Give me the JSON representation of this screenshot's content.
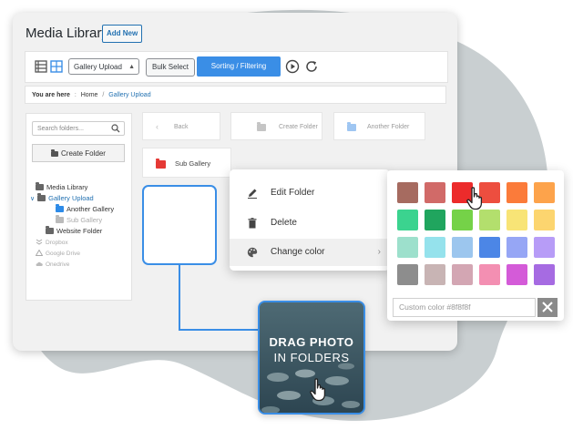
{
  "header": {
    "title": "Media Library",
    "add_new": "Add New"
  },
  "toolbar": {
    "view_list_icon": "list-view-icon",
    "view_grid_icon": "grid-view-icon",
    "folder_select": "Gallery Upload",
    "bulk_select": "Bulk Select",
    "sorting": "Sorting / Filtering",
    "play_icon": "play-circle-icon",
    "refresh_icon": "refresh-icon"
  },
  "breadcrumb": {
    "label": "You are here",
    "home": "Home",
    "current": "Gallery Upload"
  },
  "sidebar": {
    "search_placeholder": "Search folders...",
    "create_folder": "Create Folder",
    "tree": [
      {
        "label": "Media Library"
      },
      {
        "label": "Gallery Upload"
      },
      {
        "label": "Another Gallery"
      },
      {
        "label": "Sub Gallery"
      },
      {
        "label": "Website Folder"
      },
      {
        "label": "Dropbox"
      },
      {
        "label": "Google Drive"
      },
      {
        "label": "Onedrive"
      }
    ]
  },
  "folder_bar": {
    "back": "Back",
    "create_folder": "Create Folder",
    "another_folder": "Another Folder"
  },
  "sub_gallery": {
    "label": "Sub Gallery",
    "color": "#e53935"
  },
  "context_menu": {
    "edit": "Edit Folder",
    "delete": "Delete",
    "change_color": "Change color"
  },
  "palette": {
    "colors": [
      "#a66b60",
      "#d16a68",
      "#ec2b2b",
      "#ed4e3f",
      "#fb7b3a",
      "#fda34b",
      "#3bd38f",
      "#20a55e",
      "#75d248",
      "#b3df6d",
      "#f8e476",
      "#fcd56f",
      "#9de0cc",
      "#95e2ec",
      "#9cc6ee",
      "#4c86e6",
      "#96a6f5",
      "#b79cf7",
      "#8d8d8d",
      "#c8b4b4",
      "#d3a6b3",
      "#f38fb2",
      "#d45bd8",
      "#a66be2"
    ],
    "custom_placeholder": "Custom color #8f8f8f"
  },
  "drag_card": {
    "line1": "DRAG PHOTO",
    "line2": "IN FOLDERS"
  },
  "accent": "#3a8ee6"
}
